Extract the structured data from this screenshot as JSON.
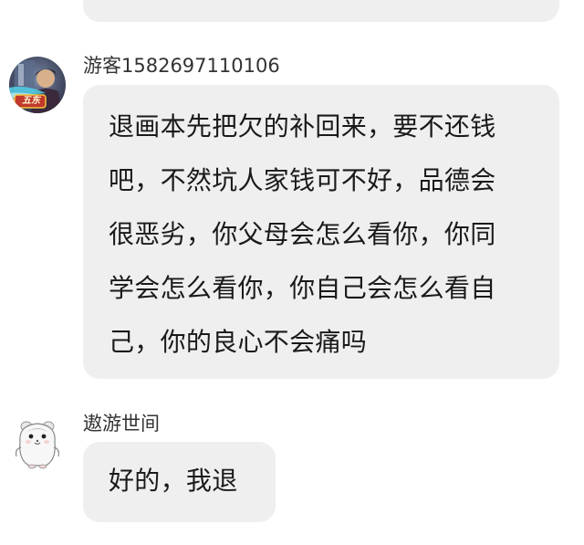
{
  "messages": [
    {
      "username": "游客1582697110106",
      "text": "退画本先把欠的补回来，要不还钱\n吧，不然坑人家钱可不好，品德会\n很恶劣，你父母会怎么看你，你同\n学会怎么看你，你自己会怎么看自\n己，你的良心不会痛吗",
      "avatar_icon": "game-character-avatar-icon",
      "avatar_badge": "五东"
    },
    {
      "username": "遨游世间",
      "text": "好的，我退",
      "avatar_icon": "hamster-avatar-icon"
    }
  ],
  "colors": {
    "bubble": "#efefef",
    "text": "#1a1a1a",
    "username": "#333333",
    "background": "#ffffff"
  }
}
